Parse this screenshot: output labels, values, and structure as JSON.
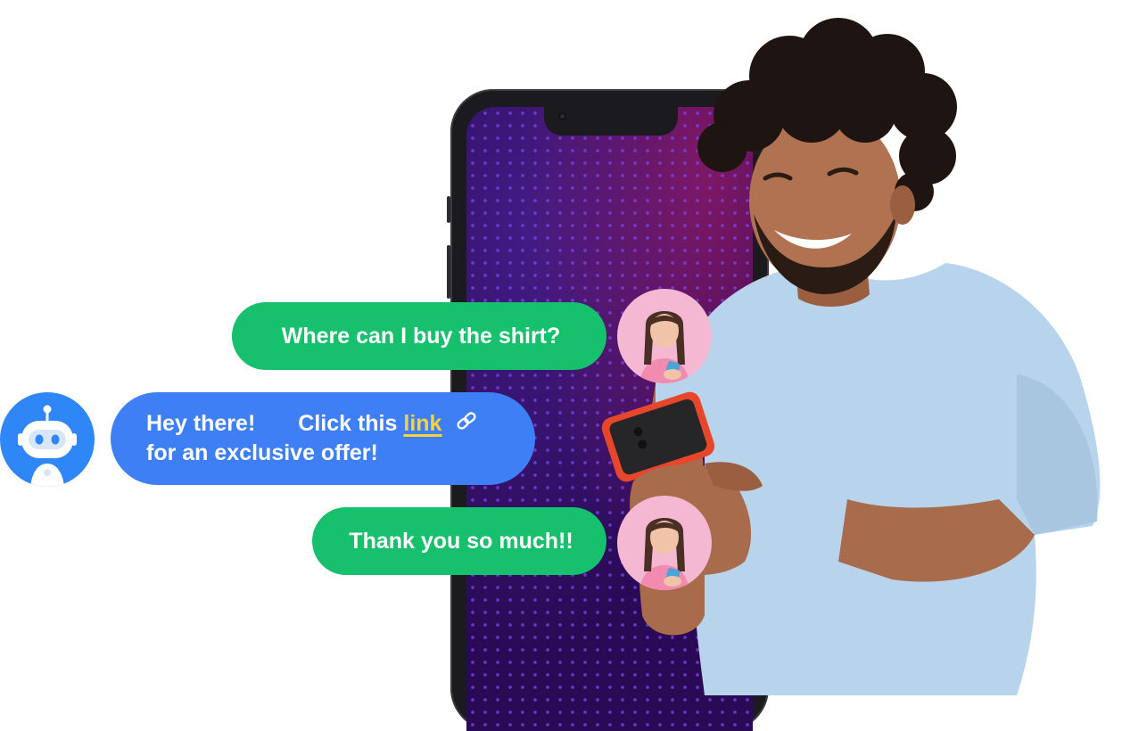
{
  "chat": {
    "message_1": "Where can I buy the shirt?",
    "message_2_part_1": "Hey there!",
    "message_2_part_2": "Click this",
    "message_2_link": "link",
    "message_2_line_2": "for an exclusive offer!",
    "message_3": "Thank you so much!!"
  },
  "icons": {
    "bot": "robot-icon",
    "link": "chain-link-icon",
    "user_avatar": "woman-avatar"
  },
  "colors": {
    "green_bubble": "#17c06c",
    "blue_bubble": "#3f7ff6",
    "link_text": "#f6d23b",
    "bot_avatar_bg": "#2f86f7",
    "user_avatar_bg": "#f4b8d2",
    "phone_screen": "#2a0a55",
    "shirt": "#b8d4ec"
  }
}
